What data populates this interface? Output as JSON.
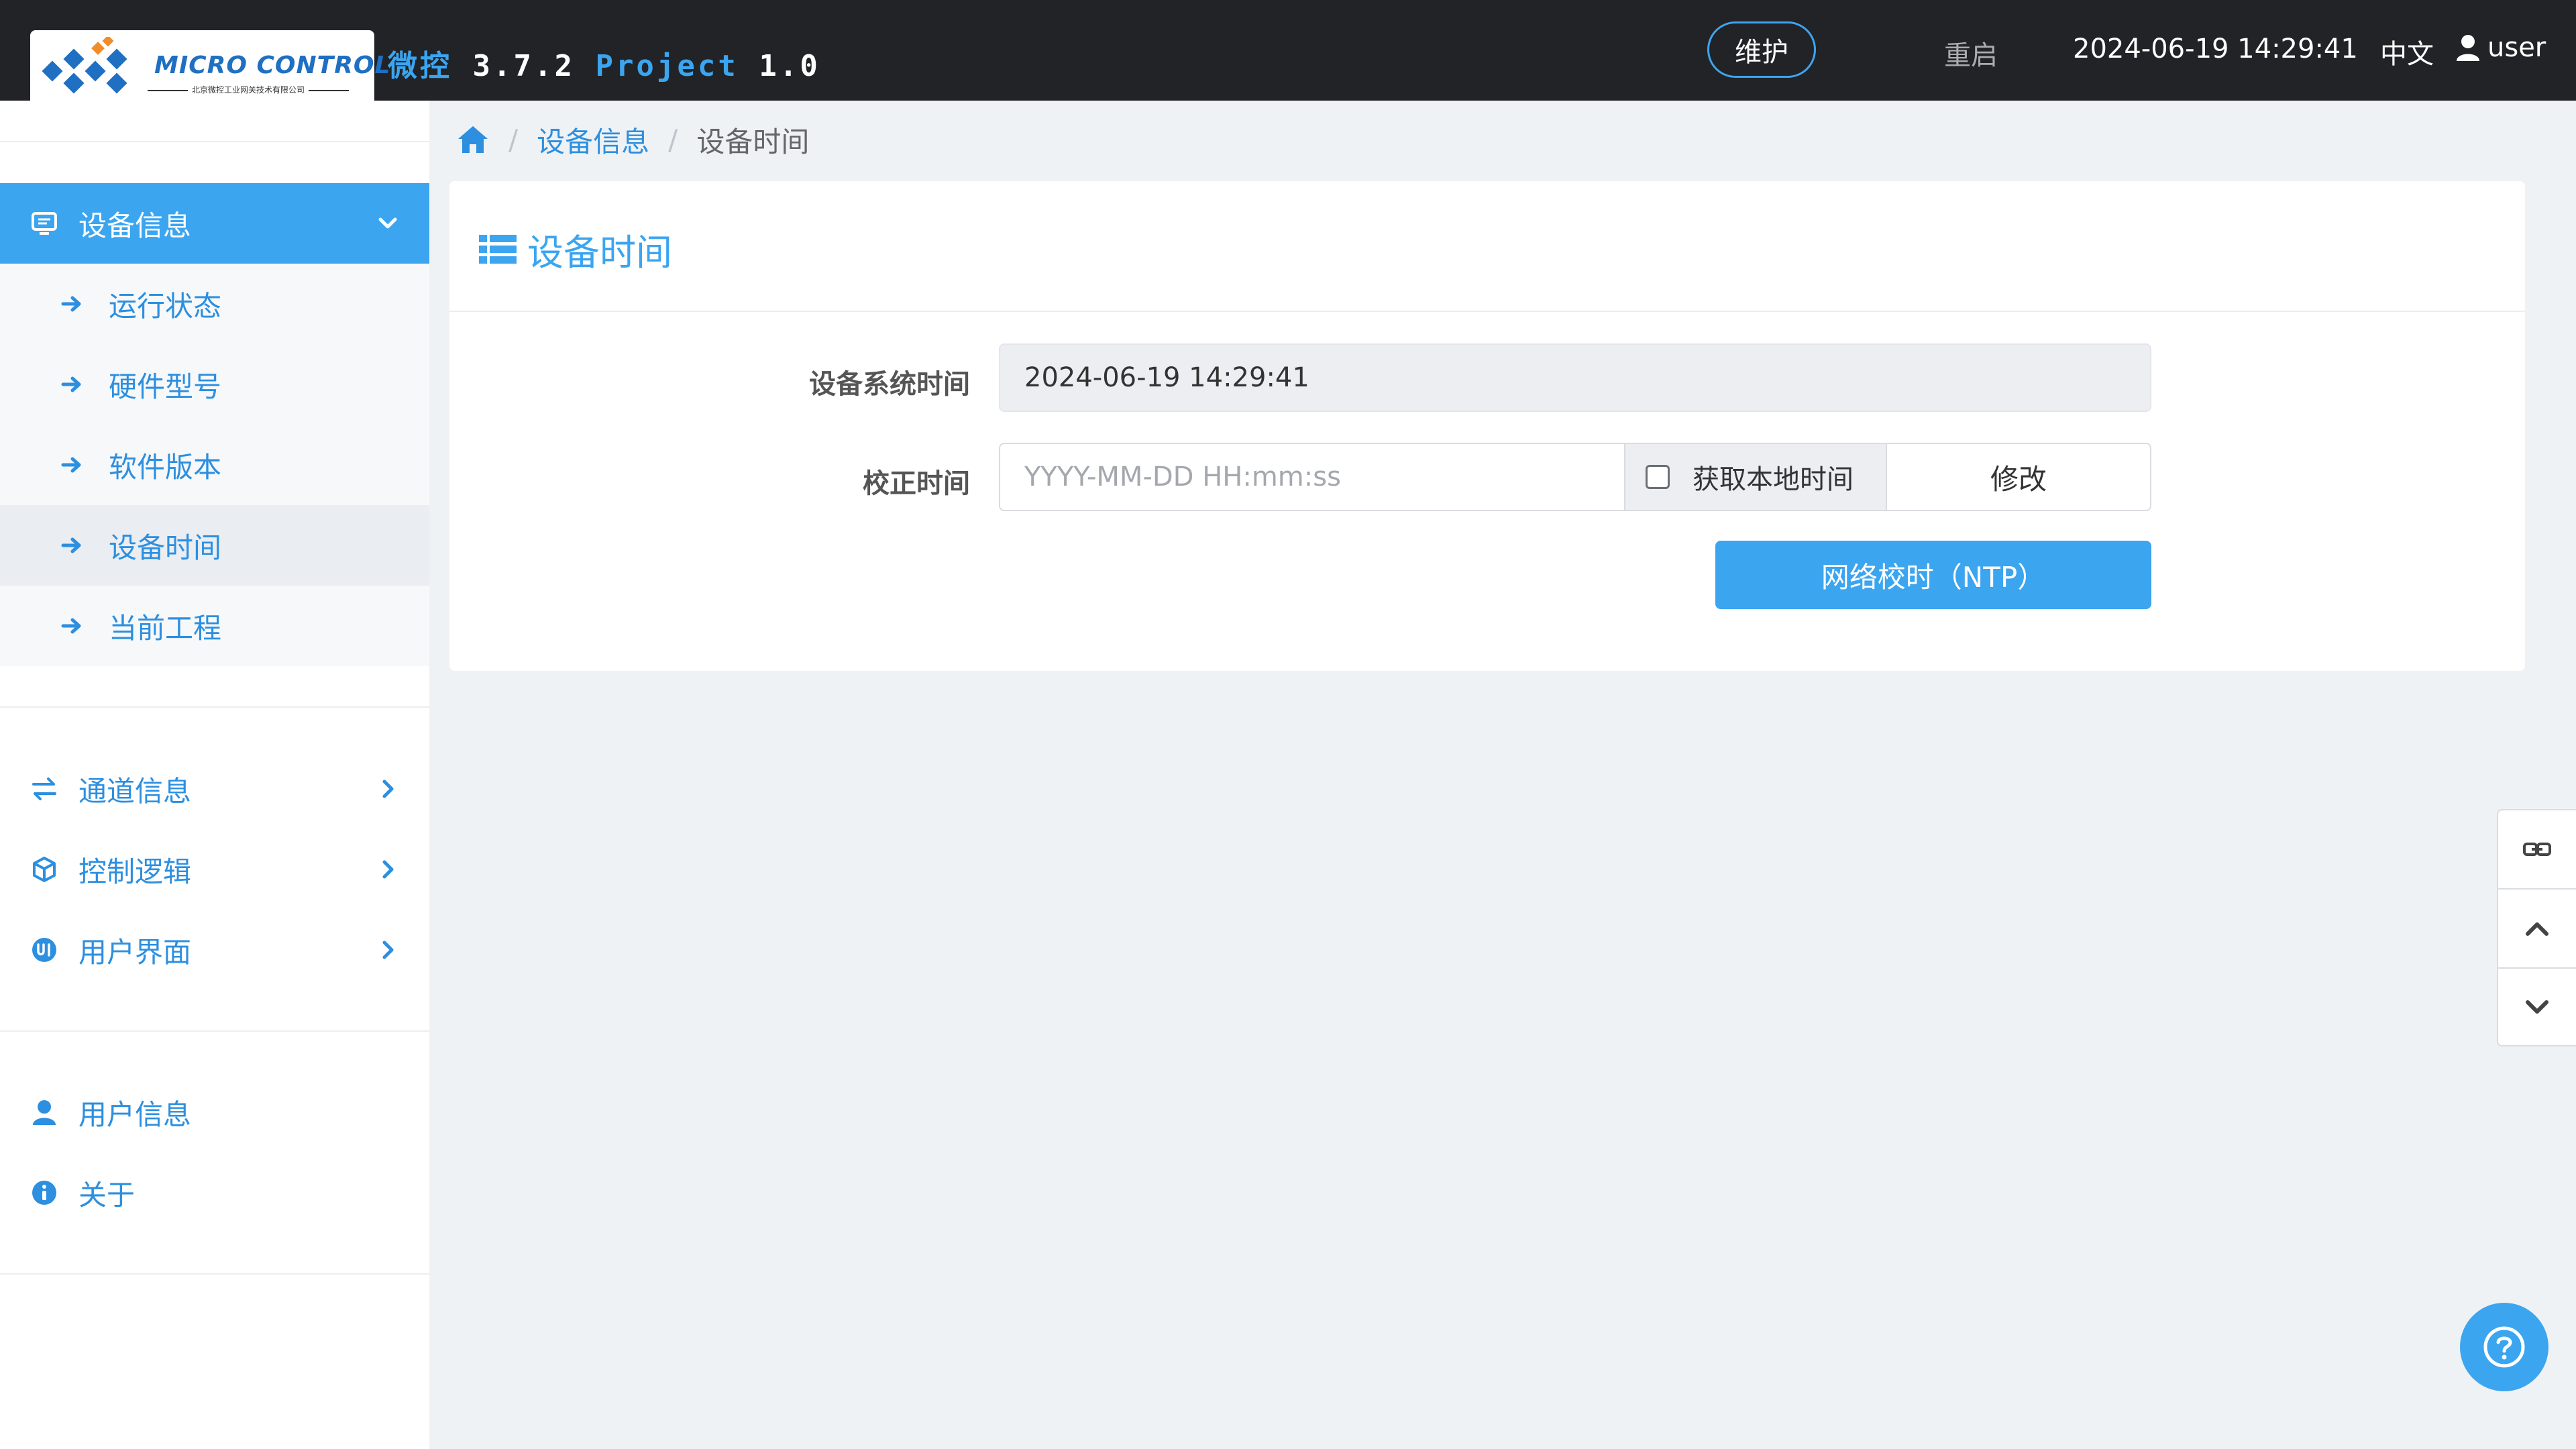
{
  "header": {
    "brand_en": "MICRO CONTROL",
    "brand_cn": "北京微控工业网关技术有限公司",
    "product": "微控",
    "version": "3.7.2",
    "project_label": "Project",
    "project_version": "1.0",
    "maintenance_label": "维护",
    "restart_label": "重启",
    "datetime": "2024-06-19 14:29:41",
    "language": "中文",
    "username": "user"
  },
  "sidebar": {
    "device_info": {
      "label": "设备信息",
      "children": [
        {
          "label": "运行状态"
        },
        {
          "label": "硬件型号"
        },
        {
          "label": "软件版本"
        },
        {
          "label": "设备时间"
        },
        {
          "label": "当前工程"
        }
      ]
    },
    "groups": [
      {
        "label": "通道信息"
      },
      {
        "label": "控制逻辑"
      },
      {
        "label": "用户界面"
      }
    ],
    "user_info_label": "用户信息",
    "about_label": "关于"
  },
  "breadcrumb": {
    "parent": "设备信息",
    "current": "设备时间"
  },
  "card": {
    "title": "设备时间",
    "system_time_label": "设备系统时间",
    "system_time_value": "2024-06-19 14:29:41",
    "correct_time_label": "校正时间",
    "correct_time_placeholder": "YYYY-MM-DD HH:mm:ss",
    "get_local_time_label": "获取本地时间",
    "modify_label": "修改",
    "ntp_label": "网络校时（NTP）"
  },
  "colors": {
    "accent": "#3ba5f0",
    "header_bg": "#222326",
    "page_bg": "#eff2f5"
  }
}
